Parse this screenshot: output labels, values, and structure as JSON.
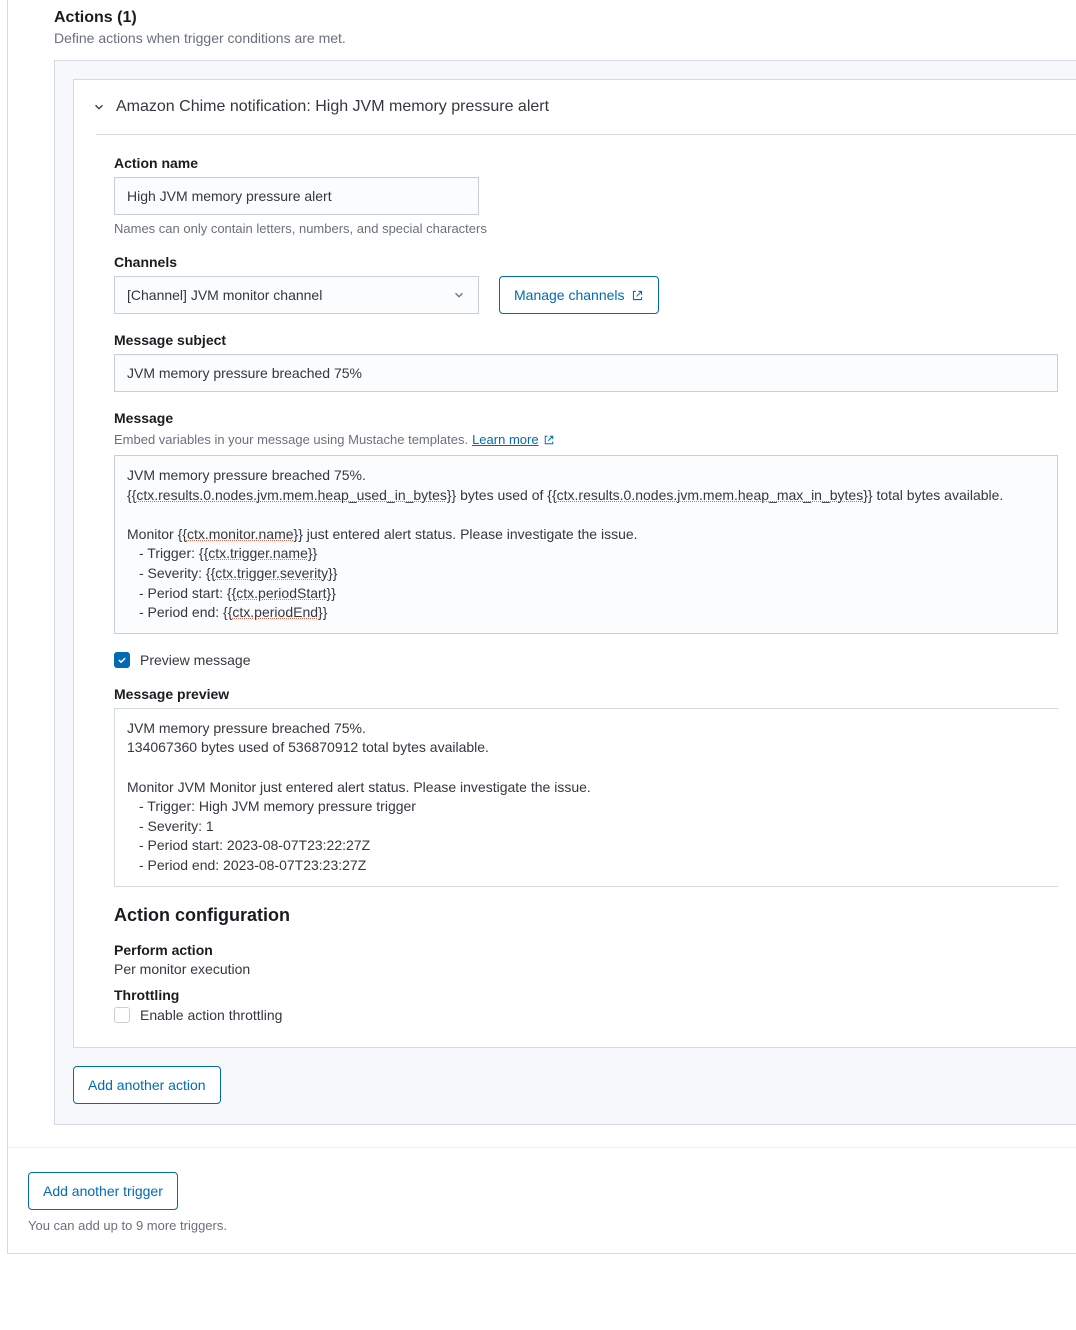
{
  "header": {
    "title": "Actions (1)",
    "subtitle": "Define actions when trigger conditions are met."
  },
  "action": {
    "accordion_title": "Amazon Chime notification: High JVM memory pressure alert",
    "name_label": "Action name",
    "name_value": "High JVM memory pressure alert",
    "name_help": "Names can only contain letters, numbers, and special characters",
    "channels_label": "Channels",
    "channel_selected": "[Channel] JVM monitor channel",
    "manage_channels": "Manage channels",
    "subject_label": "Message subject",
    "subject_value": "JVM memory pressure breached 75%",
    "message_label": "Message",
    "message_help": "Embed variables in your message using Mustache templates.",
    "message_learn_more": "Learn more",
    "message_body": {
      "l1": "JVM memory pressure breached 75%.",
      "l2a": "{{",
      "l2b": "ctx.results.0.nodes.jvm.mem.heap_used_in_bytes",
      "l2c": "}} bytes used of {{",
      "l2d": "ctx.results.0.nodes.jvm.mem.heap_max_in_bytes",
      "l2e": "}} total bytes available.",
      "l3a": "Monitor {{",
      "l3b": "ctx.monitor.name",
      "l3c": "}} just entered alert status. Please investigate the issue.",
      "l4a": "  - Trigger: {{",
      "l4b": "ctx.trigger.name",
      "l4c": "}}",
      "l5a": "  - Severity: {{",
      "l5b": "ctx.trigger.severity",
      "l5c": "}}",
      "l6a": "  - Period start: {{",
      "l6b": "ctx.periodStart",
      "l6c": "}}",
      "l7a": "  - Period end: {{",
      "l7b": "ctx.periodEnd",
      "l7c": "}}"
    },
    "preview_label": "Preview message",
    "preview_header": "Message preview",
    "preview_body": {
      "p1": "JVM memory pressure breached 75%.",
      "p2": "134067360 bytes used of 536870912 total bytes available.",
      "p3": "Monitor JVM Monitor just entered alert status. Please investigate the issue.",
      "p4": "  - Trigger: High JVM memory pressure trigger",
      "p5": "  - Severity: 1",
      "p6": "  - Period start: 2023-08-07T23:22:27Z",
      "p7": "  - Period end: 2023-08-07T23:23:27Z"
    },
    "config_title": "Action configuration",
    "perform_label": "Perform action",
    "perform_value": "Per monitor execution",
    "throttling_label": "Throttling",
    "throttling_check": "Enable action throttling",
    "add_action": "Add another action"
  },
  "trigger": {
    "add_trigger": "Add another trigger",
    "help": "You can add up to 9 more triggers."
  }
}
